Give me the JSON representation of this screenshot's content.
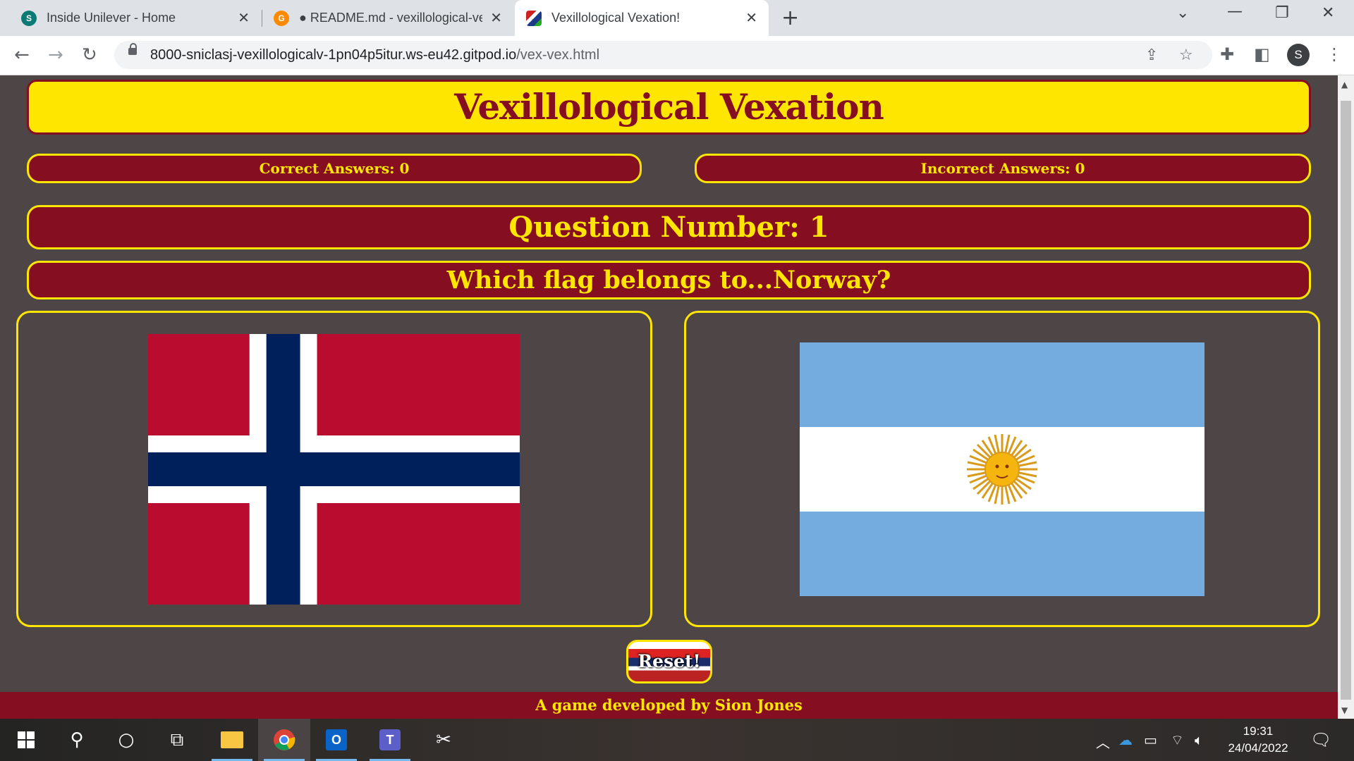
{
  "browser": {
    "tabs": [
      {
        "title": "Inside Unilever - Home",
        "favicon": "sharepoint-icon"
      },
      {
        "title": "● README.md - vexillological-ve",
        "favicon": "gitpod-icon"
      },
      {
        "title": "Vexillological Vexation!",
        "favicon": "flags-icon"
      }
    ],
    "url_host": "8000-sniclasj-vexillologicalv-1pn04p5itur.ws-eu42.gitpod.io",
    "url_path": "/vex-vex.html",
    "profile_initial": "S"
  },
  "page": {
    "heading": "Vexillological Vexation",
    "correct_label": "Correct Answers: 0",
    "incorrect_label": "Incorrect Answers: 0",
    "question_number": "Question Number: 1",
    "question_text": "Which flag belongs to...Norway?",
    "options": [
      {
        "country": "norway",
        "flag": "norway-flag"
      },
      {
        "country": "argentina",
        "flag": "argentina-flag"
      }
    ],
    "reset_label": "Reset!",
    "footer": "A game developed by Sion Jones"
  },
  "taskbar": {
    "time": "19:31",
    "date": "24/04/2022"
  },
  "colors": {
    "page_bg": "#4e4646",
    "maroon": "#850e20",
    "yellow": "#ffe600"
  }
}
